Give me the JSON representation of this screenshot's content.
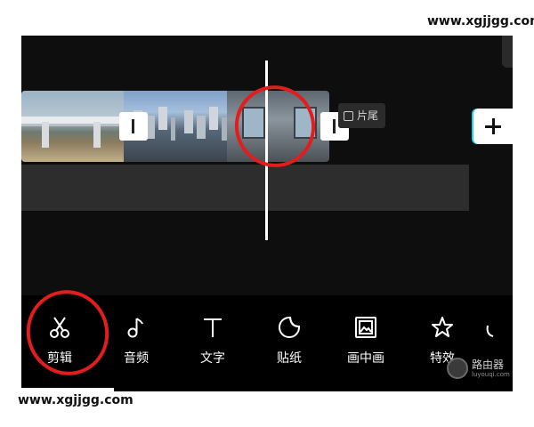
{
  "watermarks": {
    "top": "www.xgjjgg.com",
    "bottom": "www.xgjjgg.com"
  },
  "timeline": {
    "clip_frames": [
      "bridge",
      "bridge",
      "city",
      "city",
      "room",
      "room"
    ],
    "end_tag": {
      "icon": "clip-end-icon",
      "label": "片尾"
    },
    "add_button": {
      "icon": "plus-icon"
    }
  },
  "toolbar": {
    "items": [
      {
        "icon": "scissors-icon",
        "label": "剪辑"
      },
      {
        "icon": "music-note-icon",
        "label": "音频"
      },
      {
        "icon": "text-icon",
        "label": "文字"
      },
      {
        "icon": "sticker-icon",
        "label": "贴纸"
      },
      {
        "icon": "picture-in-picture-icon",
        "label": "画中画"
      },
      {
        "icon": "effects-star-icon",
        "label": "特效"
      }
    ]
  },
  "brand": {
    "name": "路由器",
    "domain": "luyouqi.com"
  },
  "colors": {
    "annotation_red": "#e11d1d",
    "editor_bg": "#0e0e0e",
    "track": "#2d2d2d"
  }
}
